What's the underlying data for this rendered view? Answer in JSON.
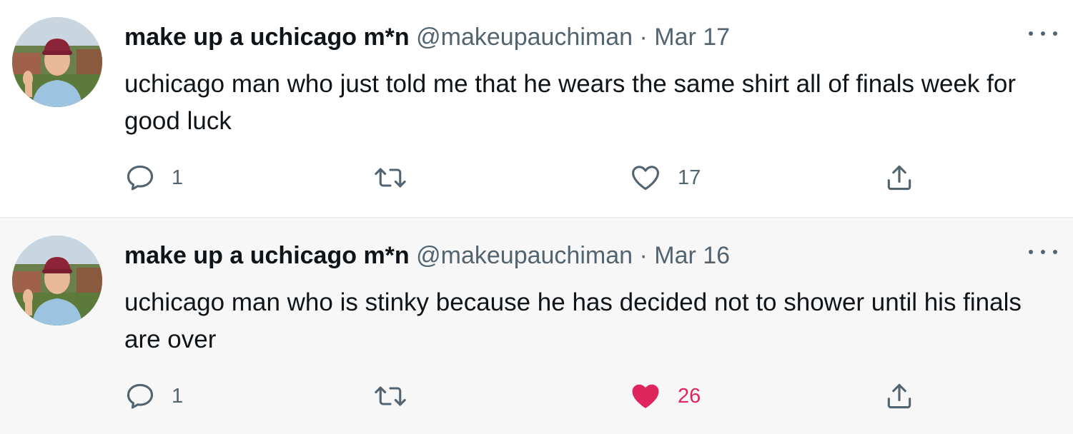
{
  "tweets": [
    {
      "display_name": "make up a uchicago m*n",
      "handle": "@makeupauchiman",
      "separator": "·",
      "date": "Mar 17",
      "text": "uchicago man who just told me that he wears the same shirt all of finals week for good luck",
      "replies": "1",
      "retweets": "",
      "likes": "17",
      "liked": false
    },
    {
      "display_name": "make up a uchicago m*n",
      "handle": "@makeupauchiman",
      "separator": "·",
      "date": "Mar 16",
      "text": "uchicago man who is stinky because he has decided not to shower until his finals are over",
      "replies": "1",
      "retweets": "",
      "likes": "26",
      "liked": true
    }
  ],
  "icons": {
    "reply": "reply-icon",
    "retweet": "retweet-icon",
    "like": "heart-icon",
    "share": "share-icon",
    "more": "more-icon"
  },
  "colors": {
    "text": "#0f1419",
    "secondary": "#536471",
    "liked": "#e0245e",
    "hover_bg": "#f7f7f7"
  }
}
